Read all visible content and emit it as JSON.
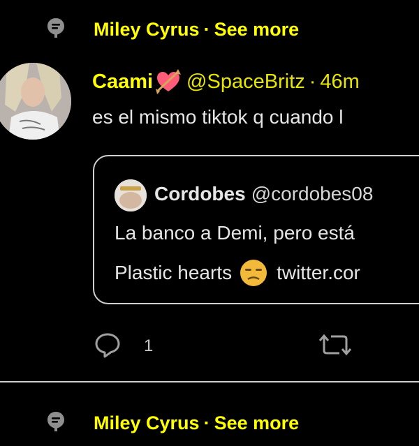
{
  "topic_rows": [
    {
      "topic": "Miley Cyrus",
      "separator": "·",
      "see_more": "See more"
    },
    {
      "topic": "Miley Cyrus",
      "separator": "·",
      "see_more": "See more"
    }
  ],
  "tweet": {
    "display_name": "Caami",
    "handle": "@SpaceBritz",
    "separator": "·",
    "time": "46m",
    "text": "es el mismo tiktok q cuando l",
    "reply_count": "1"
  },
  "quoted_tweet": {
    "display_name": "Cordobes",
    "handle": "@cordobes08",
    "line1": "La banco a Demi, pero está",
    "line2_start": "Plastic hearts",
    "line2_end": "twitter.cor"
  },
  "colors": {
    "accent": "#ffff00",
    "background": "#000000",
    "text": "#e6e6e6",
    "border": "#cfcfcf"
  },
  "icons": {
    "topic": "topic-pin-icon",
    "reply": "reply-icon",
    "retweet": "retweet-icon",
    "heart_emoji": "heart-with-arrow-emoji",
    "face_emoji": "unamused-face-emoji"
  }
}
